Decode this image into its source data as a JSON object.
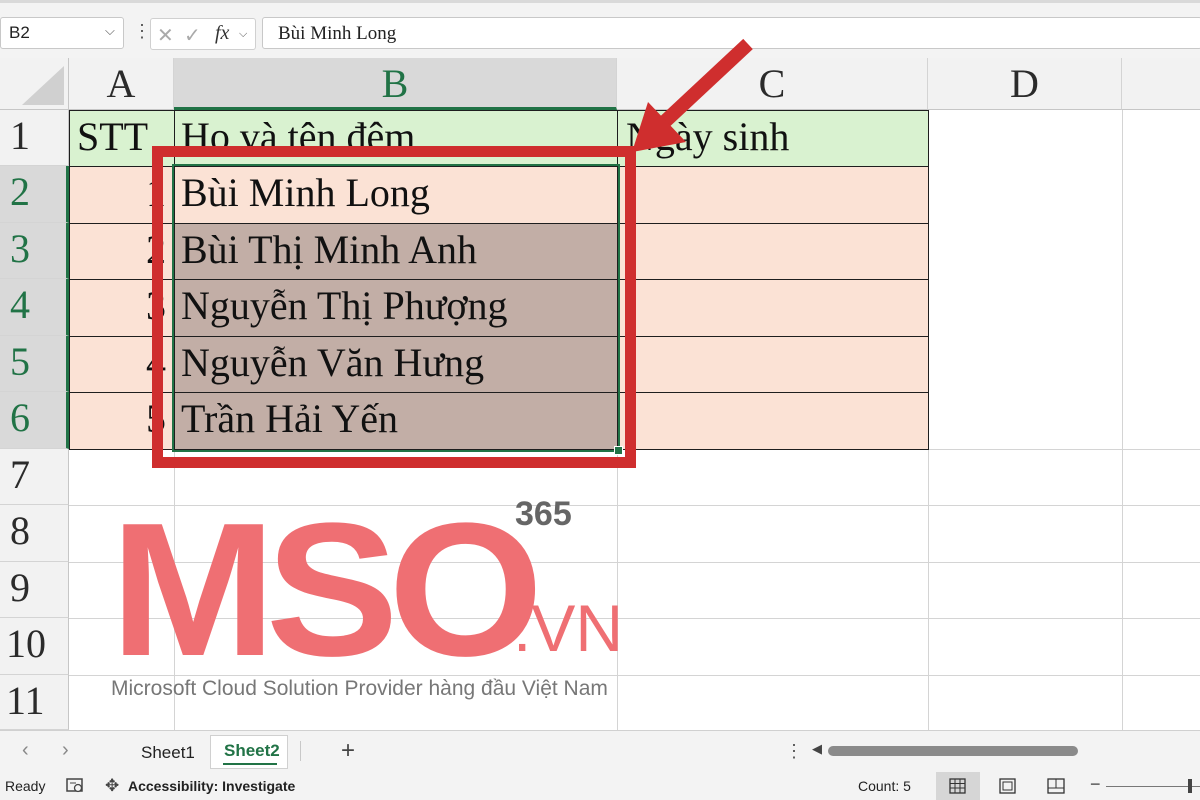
{
  "formula_bar": {
    "name_box": "B2",
    "fx_label": "fx",
    "formula_value": "Bùi Minh Long"
  },
  "columns": [
    "A",
    "B",
    "C",
    "D"
  ],
  "rows": [
    "1",
    "2",
    "3",
    "4",
    "5",
    "6",
    "7",
    "8",
    "9",
    "10",
    "11"
  ],
  "table": {
    "headers": [
      "STT",
      "Họ và tên đệm",
      "Ngày sinh"
    ],
    "stt": [
      "1",
      "2",
      "3",
      "4",
      "5"
    ],
    "names": [
      "Bùi Minh Long",
      "Bùi Thị Minh Anh",
      "Nguyễn Thị Phượng",
      "Nguyễn Văn Hưng",
      "Trần Hải Yến"
    ]
  },
  "watermark": {
    "logo_text": "MSO",
    "superscript": "365",
    "domain": ".VN",
    "tagline": "Microsoft Cloud Solution Provider hàng đầu Việt Nam"
  },
  "sheet_tabs": [
    "Sheet1",
    "Sheet2"
  ],
  "active_sheet": "Sheet2",
  "status_bar": {
    "ready": "Ready",
    "accessibility": "Accessibility: Investigate",
    "count": "Count: 5"
  },
  "colors": {
    "header_fill": "#d9f2d0",
    "data_fill": "#fbe2d5",
    "selected_fill": "#c2aea6",
    "excel_green": "#217346",
    "highlight_red": "#cf2e2e",
    "watermark_pink": "#ef6f73"
  }
}
